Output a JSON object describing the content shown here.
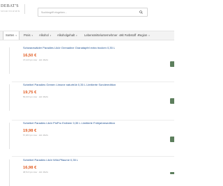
{
  "header": {
    "logo_text": "DEBAT'S",
    "logo_sub": "SPIRITUOSEN",
    "search_placeholder": "Suchbegriff eingeben...",
    "search_icon": "search-icon"
  },
  "nav": {
    "items": [
      {
        "label": "Sorten"
      },
      {
        "label": "Preis"
      },
      {
        "label": "Alkohol"
      },
      {
        "label": "Alkoholgehalt"
      },
      {
        "label": "Lebensmittelunternehmer"
      },
      {
        "label": "Mit Farbstoff"
      },
      {
        "label": "Region"
      }
    ]
  },
  "products": [
    {
      "name": "Schwarzwälder Paradies Likör Grenadine Granatapfel extra trocken 0,35 L",
      "price": "16,50 €",
      "note": "47,14 € pro Liter · inkl. MwSt."
    },
    {
      "name": "Scheibel Paradies Gemen Limone naturtrüb 0,35 L Limitierte Sonderedition",
      "price": "19,75 €",
      "note": "56,43 € pro Liter · inkl. MwSt."
    },
    {
      "name": "Scheibel Paradies Likör PinPro Erdbeer 0,35 L Limitierte Frühjahresedition",
      "price": "19,98 €",
      "note": "57,08 € pro Liter · inkl. MwSt."
    },
    {
      "name": "Scheibel Paradies Likör Wild-Pflaume 0,35 L",
      "price": "16,98 €",
      "note": "48,51 € pro Liter · inkl. MwSt."
    }
  ],
  "colors": {
    "price": "#e15a1f",
    "link": "#1d4f91",
    "cart_button": "#5d7f5d",
    "nav_bg": "#f3f3f3"
  }
}
